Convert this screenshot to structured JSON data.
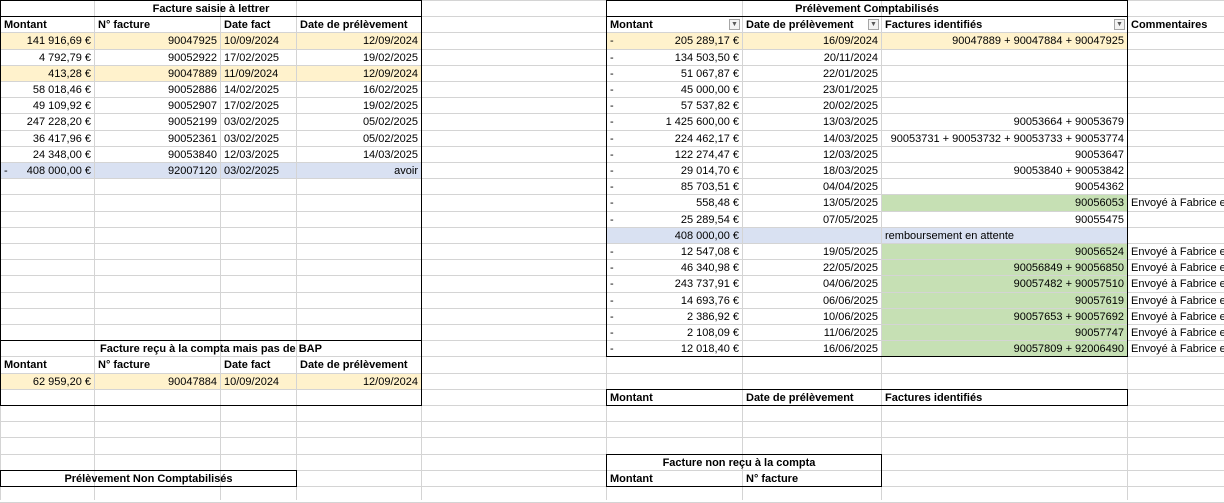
{
  "colors": {
    "grid": "#d4d4d4",
    "yellow": "#fff2cc",
    "blue": "#d9e1f2",
    "green": "#c6e0b4"
  },
  "icons": {
    "filter": "dropdown-arrow-icon",
    "sort_filter": "sort-desc-icon"
  },
  "left_table": {
    "title": "Facture saisie à lettrer",
    "headers": [
      "Montant",
      "N° facture",
      "Date fact",
      "Date de prélèvement"
    ],
    "rows": [
      {
        "prefix": "",
        "montant": "141 916,69 €",
        "facture": "90047925",
        "date_fact": "10/09/2024",
        "date_prel": "12/09/2024",
        "hl": "yellow"
      },
      {
        "prefix": "",
        "montant": "4 792,79 €",
        "facture": "90052922",
        "date_fact": "17/02/2025",
        "date_prel": "19/02/2025",
        "hl": ""
      },
      {
        "prefix": "",
        "montant": "413,28 €",
        "facture": "90047889",
        "date_fact": "11/09/2024",
        "date_prel": "12/09/2024",
        "hl": "yellow"
      },
      {
        "prefix": "",
        "montant": "58 018,46 €",
        "facture": "90052886",
        "date_fact": "14/02/2025",
        "date_prel": "16/02/2025",
        "hl": ""
      },
      {
        "prefix": "",
        "montant": "49 109,92 €",
        "facture": "90052907",
        "date_fact": "17/02/2025",
        "date_prel": "19/02/2025",
        "hl": ""
      },
      {
        "prefix": "",
        "montant": "247 228,20 €",
        "facture": "90052199",
        "date_fact": "03/02/2025",
        "date_prel": "05/02/2025",
        "hl": ""
      },
      {
        "prefix": "",
        "montant": "36 417,96 €",
        "facture": "90052361",
        "date_fact": "03/02/2025",
        "date_prel": "05/02/2025",
        "hl": ""
      },
      {
        "prefix": "",
        "montant": "24 348,00 €",
        "facture": "90053840",
        "date_fact": "12/03/2025",
        "date_prel": "14/03/2025",
        "hl": ""
      },
      {
        "prefix": "-",
        "montant": "408 000,00 €",
        "facture": "92007120",
        "date_fact": "03/02/2025",
        "date_prel": "avoir",
        "hl": "blue"
      }
    ]
  },
  "bap_table": {
    "title": "Facture reçu à la compta mais pas de BAP",
    "headers": [
      "Montant",
      "N° facture",
      "Date fact",
      "Date de prélèvement"
    ],
    "rows": [
      {
        "montant": "62 959,20 €",
        "facture": "90047884",
        "date_fact": "10/09/2024",
        "date_prel": "12/09/2024",
        "hl": "yellow"
      }
    ]
  },
  "non_compta_table": {
    "title": "Prélèvement Non Comptabilisés"
  },
  "right_table": {
    "title": "Prélèvement Comptabilisés",
    "headers": [
      "Montant",
      "Date de prélèvement",
      "Factures identifiés",
      "Commentaires"
    ],
    "rows": [
      {
        "prefix": "-",
        "montant": "205 289,17 €",
        "date": "16/09/2024",
        "factures": "90047889 + 90047884 + 90047925",
        "comment": "",
        "hl": "yellow"
      },
      {
        "prefix": "-",
        "montant": "134 503,50 €",
        "date": "20/11/2024",
        "factures": "",
        "comment": "",
        "hl": ""
      },
      {
        "prefix": "-",
        "montant": "51 067,87 €",
        "date": "22/01/2025",
        "factures": "",
        "comment": "",
        "hl": ""
      },
      {
        "prefix": "-",
        "montant": "45 000,00 €",
        "date": "23/01/2025",
        "factures": "",
        "comment": "",
        "hl": ""
      },
      {
        "prefix": "-",
        "montant": "57 537,82 €",
        "date": "20/02/2025",
        "factures": "",
        "comment": "",
        "hl": ""
      },
      {
        "prefix": "-",
        "montant": "1 425 600,00 €",
        "date": "13/03/2025",
        "factures": "90053664 + 90053679",
        "comment": "",
        "hl": ""
      },
      {
        "prefix": "-",
        "montant": "224 462,17 €",
        "date": "14/03/2025",
        "factures": "90053731 + 90053732 + 90053733 + 90053774",
        "comment": "",
        "hl": ""
      },
      {
        "prefix": "-",
        "montant": "122 274,47 €",
        "date": "12/03/2025",
        "factures": "90053647",
        "comment": "",
        "hl": ""
      },
      {
        "prefix": "-",
        "montant": "29 014,70 €",
        "date": "18/03/2025",
        "factures": "90053840 + 90053842",
        "comment": "",
        "hl": ""
      },
      {
        "prefix": "-",
        "montant": "85 703,51 €",
        "date": "04/04/2025",
        "factures": "90054362",
        "comment": "",
        "hl": ""
      },
      {
        "prefix": "-",
        "montant": "558,48 €",
        "date": "13/05/2025",
        "factures": "90056053",
        "comment": "Envoyé à Fabrice e",
        "hl": "green"
      },
      {
        "prefix": "-",
        "montant": "25 289,54 €",
        "date": "07/05/2025",
        "factures": "90055475",
        "comment": "",
        "hl": ""
      },
      {
        "prefix": "",
        "montant": "408 000,00 €",
        "date": "",
        "factures": "remboursement en attente",
        "comment": "",
        "hl": "blue"
      },
      {
        "prefix": "-",
        "montant": "12 547,08 €",
        "date": "19/05/2025",
        "factures": "90056524",
        "comment": "Envoyé à Fabrice e",
        "hl": "green"
      },
      {
        "prefix": "-",
        "montant": "46 340,98 €",
        "date": "22/05/2025",
        "factures": "90056849 + 90056850",
        "comment": "Envoyé à Fabrice e",
        "hl": "green"
      },
      {
        "prefix": "-",
        "montant": "243 737,91 €",
        "date": "04/06/2025",
        "factures": "90057482 + 90057510",
        "comment": "Envoyé à Fabrice e",
        "hl": "green"
      },
      {
        "prefix": "-",
        "montant": "14 693,76 €",
        "date": "06/06/2025",
        "factures": "90057619",
        "comment": "Envoyé à Fabrice e",
        "hl": "green"
      },
      {
        "prefix": "-",
        "montant": "2 386,92 €",
        "date": "10/06/2025",
        "factures": "90057653 + 90057692",
        "comment": "Envoyé à Fabrice e",
        "hl": "green"
      },
      {
        "prefix": "-",
        "montant": "2 108,09 €",
        "date": "11/06/2025",
        "factures": "90057747",
        "comment": "Envoyé à Fabrice e",
        "hl": "green"
      },
      {
        "prefix": "-",
        "montant": "12 018,40 €",
        "date": "16/06/2025",
        "factures": "90057809 + 92006490",
        "comment": "Envoyé à Fabrice e",
        "hl": "green"
      }
    ]
  },
  "right_lower_table": {
    "headers": [
      "Montant",
      "Date de prélèvement",
      "Factures identifiés"
    ]
  },
  "non_recu_table": {
    "title": "Facture non reçu à la compta",
    "headers": [
      "Montant",
      "N° facture"
    ]
  }
}
